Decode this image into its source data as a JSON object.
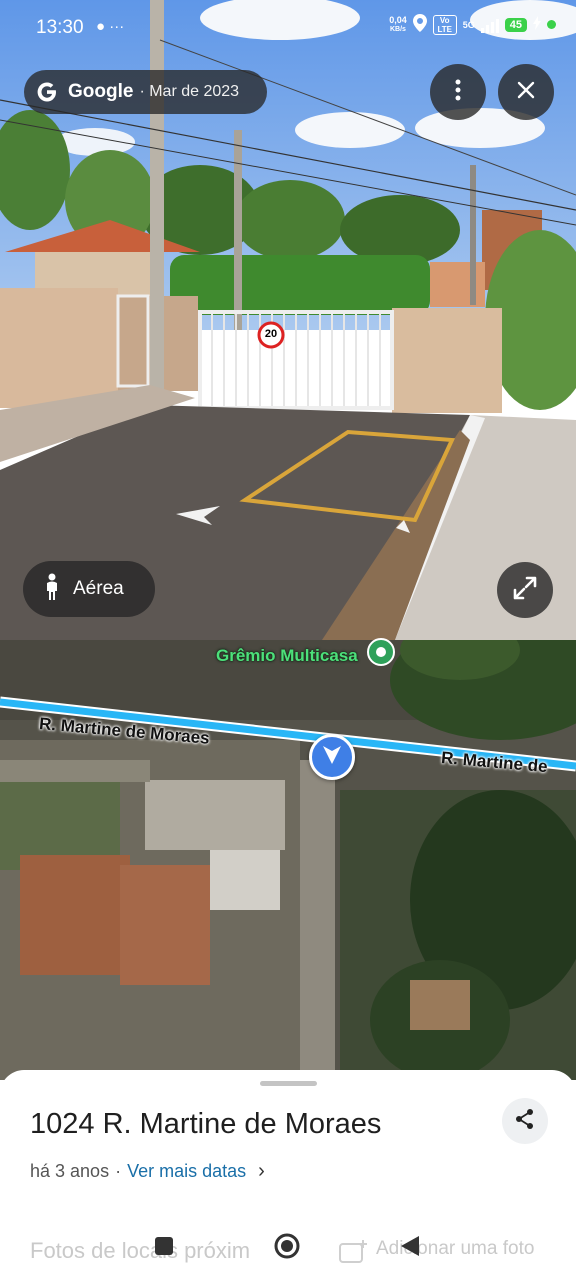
{
  "status_bar": {
    "time": "13:30",
    "left_icons": "● ···",
    "net_speed_value": "0,04",
    "net_speed_unit": "KB/s",
    "volte": "Vo LTE",
    "network": "5G",
    "battery": "45",
    "accent": "#3bd14a"
  },
  "street_view": {
    "source_label": "Google",
    "date_label": "· Mar de 2023",
    "more_icon": "more-vert-icon",
    "close_icon": "close-icon",
    "mode_button_label": "Aérea",
    "mode_icon": "pegman-icon",
    "expand_icon": "expand-icon",
    "speed_sign": "20"
  },
  "map": {
    "poi_label": "Grêmio Multicasa",
    "street_label_left": "R. Martine de Moraes",
    "street_label_right": "R. Martine de",
    "road_color": "#29b6f6",
    "nav_color": "#3f7fe6"
  },
  "sheet": {
    "address": "1024 R. Martine de Moraes",
    "age": "há 3 anos",
    "separator": "·",
    "more_dates_link": "Ver mais datas",
    "chevron": "›",
    "faded_left": "Fotos de locais próxim",
    "faded_right": "Adicionar uma foto",
    "share_icon": "share-icon"
  },
  "nav_bar": {
    "recents_icon": "square-icon",
    "home_icon": "circle-icon",
    "back_icon": "triangle-back-icon"
  }
}
